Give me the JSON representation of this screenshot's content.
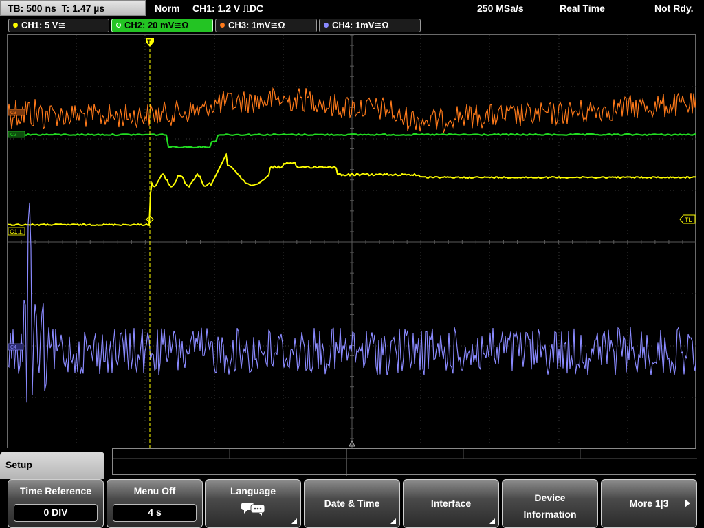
{
  "status": {
    "timebase": "TB: 500 ns",
    "trigger_time": "T: 1.47 µs",
    "trigger_mode": "Norm",
    "trigger_source": "CH1: 1.2 V ⎍DC",
    "sample_rate": "250 MSa/s",
    "acq_mode": "Real Time",
    "ready_state": "Not Rdy."
  },
  "channels": [
    {
      "label": "CH1: 5 V≅",
      "color": "#ffff00",
      "marker": "C1⊥"
    },
    {
      "label": "CH2: 20 mV≅Ω",
      "color": "#22dd22",
      "marker": "C2"
    },
    {
      "label": "CH3: 1mV≅Ω",
      "color": "#ff7a1a",
      "marker": "C3"
    },
    {
      "label": "CH4: 1mV≅Ω",
      "color": "#8a8aff",
      "marker": "C4"
    }
  ],
  "trigger_level_label": "TL",
  "menu": {
    "title": "Setup",
    "softkeys": [
      {
        "label": "Time Reference",
        "value": "0 DIV"
      },
      {
        "label": "Menu Off",
        "value": "4 s"
      },
      {
        "label": "Language",
        "icon": "speech-bubble-icon"
      },
      {
        "label": "Date & Time"
      },
      {
        "label": "Interface"
      },
      {
        "label": "Device",
        "label2": "Information"
      },
      {
        "label": "More 1|3"
      }
    ]
  }
}
